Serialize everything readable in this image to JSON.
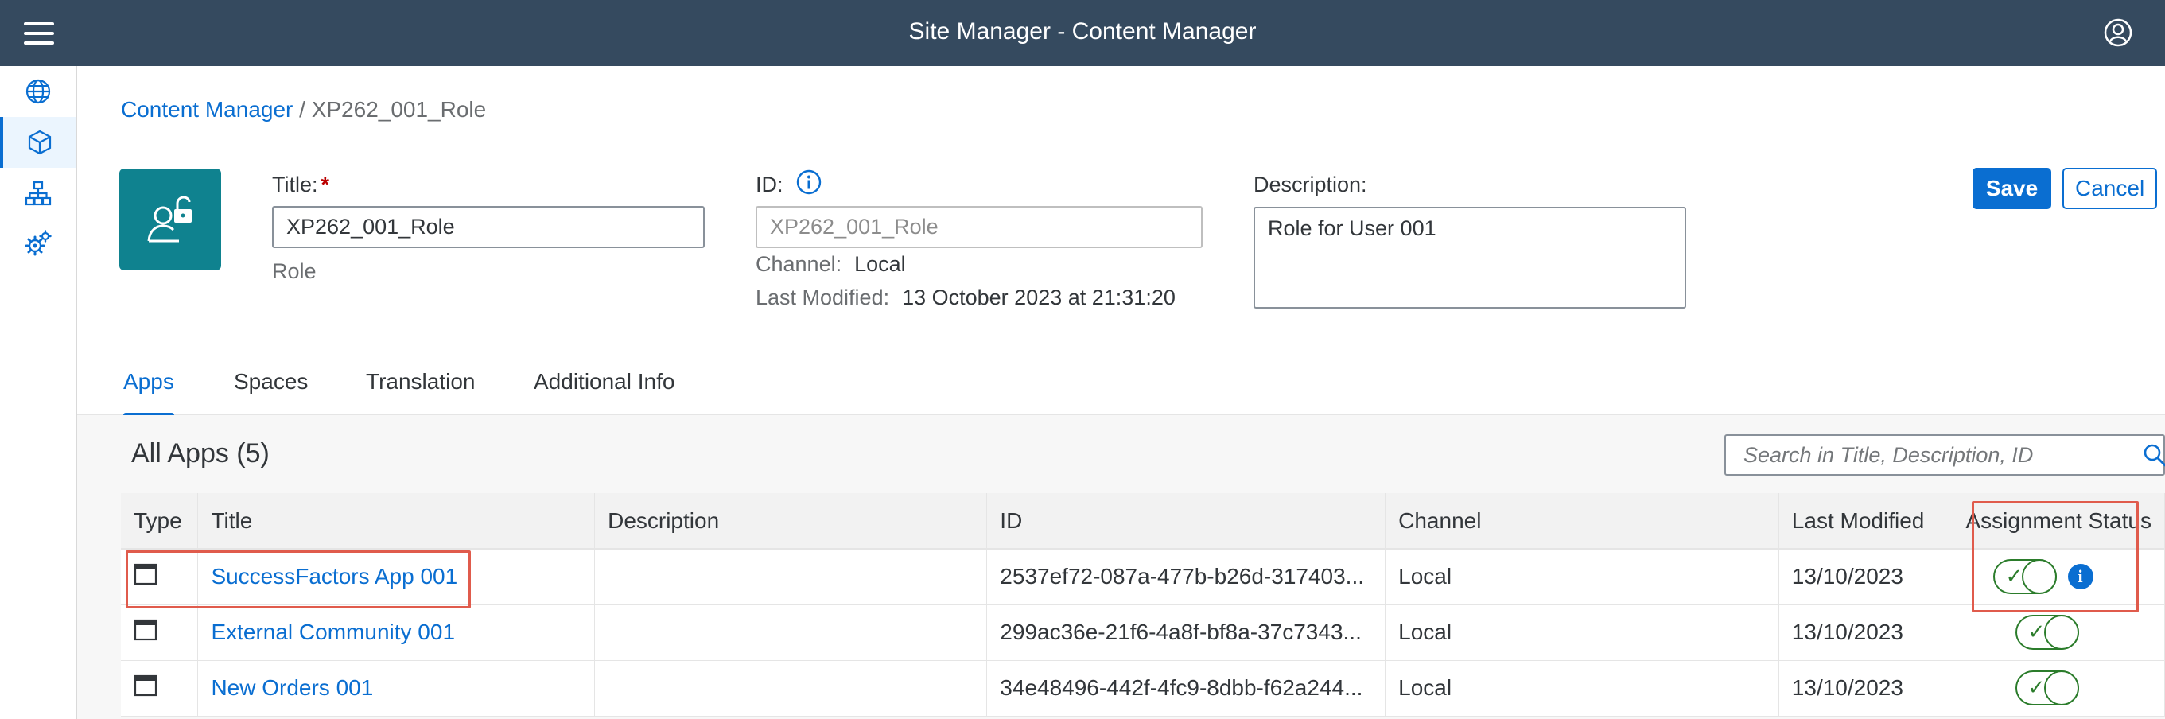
{
  "shell": {
    "title": "Site Manager - Content Manager",
    "menu_icon": "hamburger-icon",
    "profile_icon": "user-profile-icon"
  },
  "sidenav": {
    "items": [
      {
        "icon": "globe-icon",
        "active": false
      },
      {
        "icon": "cube-icon",
        "active": true
      },
      {
        "icon": "hierarchy-icon",
        "active": false
      },
      {
        "icon": "settings-gears-icon",
        "active": false
      }
    ]
  },
  "breadcrumb": {
    "link": "Content Manager",
    "separator": "/",
    "current": "XP262_001_Role"
  },
  "header": {
    "tile_icon": "role-unlock-user-icon",
    "title_label": "Title:",
    "title_required": "*",
    "title_value": "XP262_001_Role",
    "type_text": "Role",
    "id_label": "ID:",
    "id_value": "XP262_001_Role",
    "channel_label": "Channel:",
    "channel_value": "Local",
    "modified_label": "Last Modified:",
    "modified_value": "13 October 2023 at 21:31:20",
    "description_label": "Description:",
    "description_value": "Role for User 001",
    "save_label": "Save",
    "cancel_label": "Cancel"
  },
  "tabs": [
    {
      "label": "Apps",
      "active": true
    },
    {
      "label": "Spaces",
      "active": false
    },
    {
      "label": "Translation",
      "active": false
    },
    {
      "label": "Additional Info",
      "active": false
    }
  ],
  "apps": {
    "title": "All Apps (5)",
    "search_placeholder": "Search in Title, Description, ID",
    "columns": [
      "Type",
      "Title",
      "Description",
      "ID",
      "Channel",
      "Last Modified",
      "Assignment Status"
    ],
    "rows": [
      {
        "title": "SuccessFactors App 001",
        "description": "",
        "id": "2537ef72-087a-477b-b26d-317403...",
        "channel": "Local",
        "modified": "13/10/2023",
        "assigned": true,
        "info": "i"
      },
      {
        "title": "External Community 001",
        "description": "",
        "id": "299ac36e-21f6-4a8f-bf8a-37c7343...",
        "channel": "Local",
        "modified": "13/10/2023",
        "assigned": true,
        "info": ""
      },
      {
        "title": "New Orders 001",
        "description": "",
        "id": "34e48496-442f-4fc9-8dbb-f62a244...",
        "channel": "Local",
        "modified": "13/10/2023",
        "assigned": true,
        "info": ""
      }
    ],
    "toggle_check": "✓"
  },
  "colors": {
    "shell": "#354a5f",
    "accent": "#0a6ed1",
    "tile": "#0f828f",
    "success": "#2b7c2b",
    "highlight": "#e05b4c"
  }
}
